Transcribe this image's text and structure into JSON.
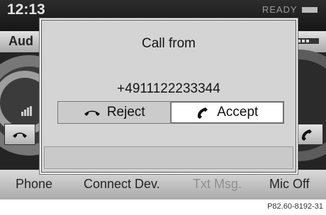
{
  "statusbar": {
    "time": "12:13",
    "status_text": "READY"
  },
  "tabs": {
    "left_label": "Aud"
  },
  "dialog": {
    "title": "Call from",
    "number": "+4911122233344",
    "reject_label": "Reject",
    "accept_label": "Accept"
  },
  "bottom_menu": {
    "items": [
      "Phone",
      "Connect Dev.",
      "Txt Msg.",
      "Mic Off"
    ],
    "disabled": [
      "Txt Msg."
    ]
  },
  "caption": "P82.60-8192-31",
  "icons": {
    "reject": "hang-up-handset-icon",
    "accept": "pick-up-handset-icon",
    "signal": "signal-strength-icon",
    "menu": "grid-icon"
  },
  "colors": {
    "screen_bg": "#242424",
    "dialog_bg": "#d4d4d4",
    "accept_bg": "#ffffff",
    "disabled_text": "#8e8e8e"
  }
}
